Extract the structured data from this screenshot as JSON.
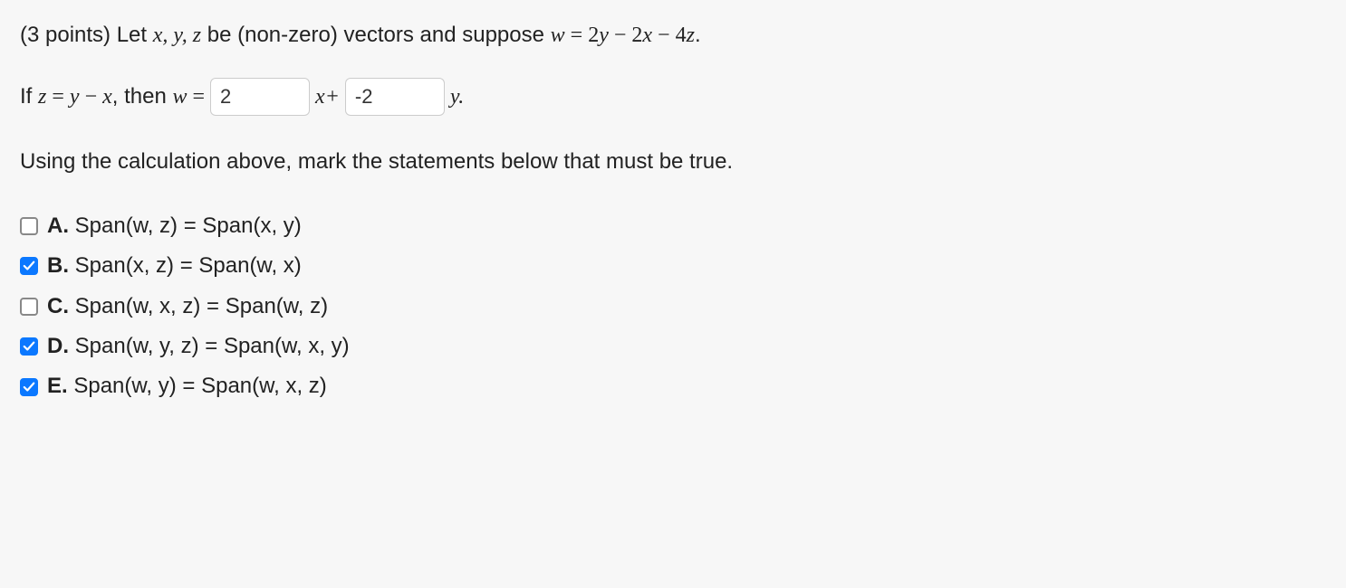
{
  "problem": {
    "points_prefix": "(3 points) Let ",
    "vars1": "x, y, z",
    "mid1": " be (non-zero) vectors and suppose ",
    "eq_lhs": "w",
    "eq_equals": " = ",
    "eq_rhs_1": "2",
    "eq_rhs_y": "y",
    "eq_rhs_2": " − 2",
    "eq_rhs_x": "x",
    "eq_rhs_3": " − 4",
    "eq_rhs_z": "z",
    "period": "."
  },
  "equation_row": {
    "prefix": "If ",
    "z": "z",
    "equals1": " = ",
    "y": "y",
    "minus": " − ",
    "x": "x",
    "comma_then": ", then ",
    "w": "w",
    "equals2": " = ",
    "input1_value": "2",
    "x_plus": "x+",
    "input2_value": "-2",
    "y_period": "y."
  },
  "instruction": "Using the calculation above, mark the statements below that must be true.",
  "choices": [
    {
      "letter": "A.",
      "text": " Span(w, z) = Span(x, y)",
      "checked": false
    },
    {
      "letter": "B.",
      "text": " Span(x, z) = Span(w, x)",
      "checked": true
    },
    {
      "letter": "C.",
      "text": " Span(w, x, z) = Span(w, z)",
      "checked": false
    },
    {
      "letter": "D.",
      "text": " Span(w, y, z) = Span(w, x, y)",
      "checked": true
    },
    {
      "letter": "E.",
      "text": " Span(w, y) = Span(w, x, z)",
      "checked": true
    }
  ]
}
